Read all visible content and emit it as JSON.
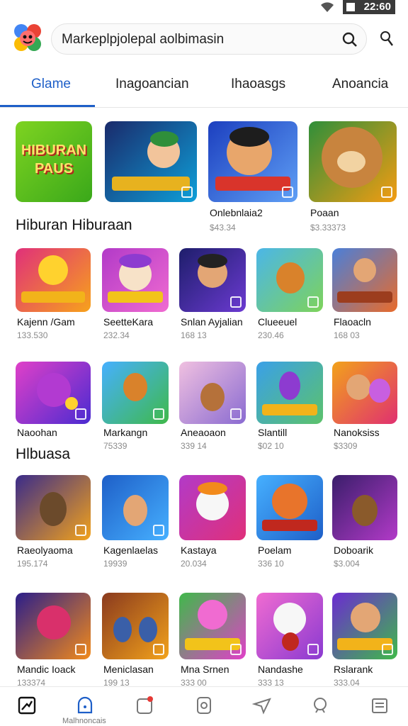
{
  "status": {
    "time": "22:60"
  },
  "search": {
    "text": "Markeplpjolepal aolbimasin"
  },
  "tabs": [
    {
      "label": "Glame",
      "active": true
    },
    {
      "label": "Inagoancian",
      "active": false
    },
    {
      "label": "Ihaoasgs",
      "active": false
    },
    {
      "label": "Anoancia",
      "active": false
    }
  ],
  "featured": {
    "section_title": "Hiburan Hiburaan",
    "banner_text": "HIBURAN PAUS",
    "cards": [
      {
        "name": "",
        "meta": ""
      },
      {
        "name": "",
        "meta": ""
      },
      {
        "name": "Onlebnlaia2",
        "meta": "$43.34"
      },
      {
        "name": "Poaan",
        "meta": "$3.33373"
      }
    ]
  },
  "row2": [
    {
      "name": "Kajenn /Gam",
      "meta": "133.530"
    },
    {
      "name": "SeetteKara",
      "meta": "232.34"
    },
    {
      "name": "Snlan Ayjalian",
      "meta": "168 13"
    },
    {
      "name": "Clueeuel",
      "meta": "230.46"
    },
    {
      "name": "Flaoacln",
      "meta": "168 03"
    }
  ],
  "row3": {
    "section_title": "Hlbuasa",
    "cards": [
      {
        "name": "Naoohan",
        "meta": ""
      },
      {
        "name": "Markangn",
        "meta": "75339"
      },
      {
        "name": "Aneaoaon",
        "meta": "339 14"
      },
      {
        "name": "Slantill",
        "meta": "$02 10"
      },
      {
        "name": "Nanoksiss",
        "meta": "$3309"
      }
    ]
  },
  "row4": [
    {
      "name": "Raeolyaoma",
      "meta": "195.174"
    },
    {
      "name": "Kagenlaelas",
      "meta": "19939"
    },
    {
      "name": "Kastaya",
      "meta": "20.034"
    },
    {
      "name": "Poelam",
      "meta": "336 10"
    },
    {
      "name": "Doboarik",
      "meta": "$3.004"
    }
  ],
  "row5": [
    {
      "name": "Mandic Ioack",
      "meta": "133374"
    },
    {
      "name": "Meniclasan",
      "meta": "199 13"
    },
    {
      "name": "Mna Srnen",
      "meta": "333 00"
    },
    {
      "name": "Nandashe",
      "meta": "333 13"
    },
    {
      "name": "Rslarank",
      "meta": "333.04"
    }
  ],
  "bottom_nav": {
    "active_label": "Malhnoncais"
  },
  "colors": {
    "accent": "#1e5fc8",
    "badge": "#e53935"
  }
}
